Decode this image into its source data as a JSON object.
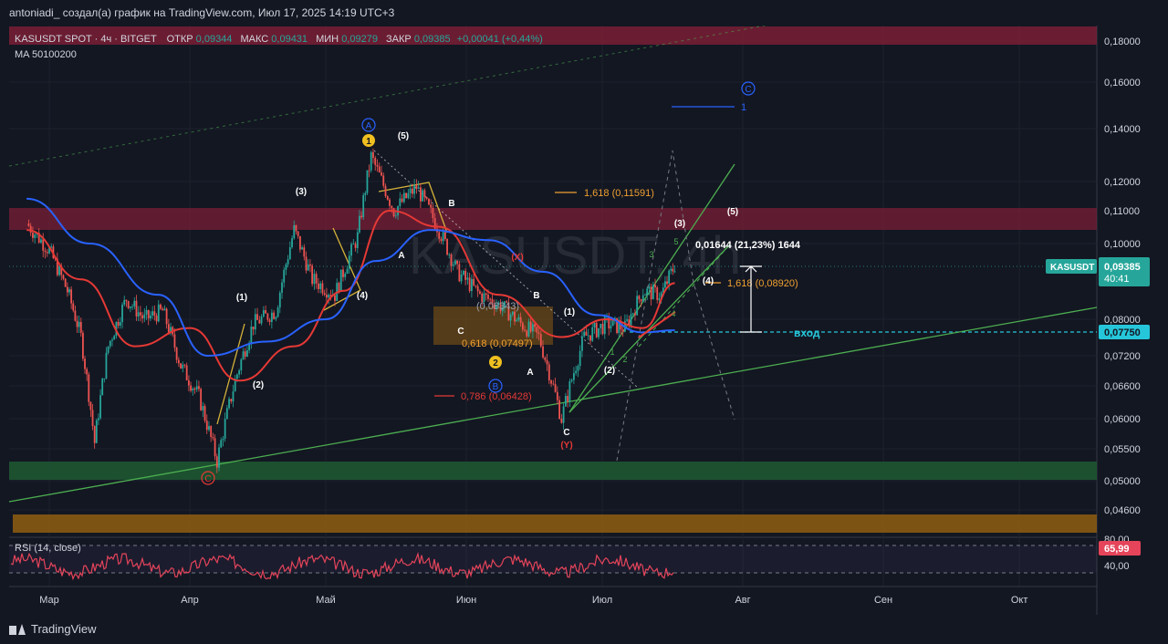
{
  "header": {
    "author_line": "antoniadi_ создал(а) график на TradingView.com, Июл 17, 2025 14:19 UTC+3"
  },
  "legend": {
    "symbol": "KASUSDT SPOT · 4ч · BITGET",
    "open_label": "ОТКР",
    "open_value": "0,09344",
    "high_label": "МАКС",
    "high_value": "0,09431",
    "low_label": "МИН",
    "low_value": "0,09279",
    "close_label": "ЗАКР",
    "close_value": "0,09385",
    "change": "+0,00041 (+0,44%)",
    "ma_line": "MA 50100200"
  },
  "watermark": "KASUSDT, 4h",
  "price_axis": {
    "ticks": [
      {
        "label": "0,18000",
        "value": 0.18
      },
      {
        "label": "0,16000",
        "value": 0.16
      },
      {
        "label": "0,14000",
        "value": 0.14
      },
      {
        "label": "0,12000",
        "value": 0.12
      },
      {
        "label": "0,11000",
        "value": 0.11
      },
      {
        "label": "0,10000",
        "value": 0.1
      },
      {
        "label": "0,08000",
        "value": 0.08
      },
      {
        "label": "0,07200",
        "value": 0.072
      },
      {
        "label": "0,06600",
        "value": 0.066
      },
      {
        "label": "0,06000",
        "value": 0.06
      },
      {
        "label": "0,05500",
        "value": 0.055
      },
      {
        "label": "0,05000",
        "value": 0.05
      },
      {
        "label": "0,04600",
        "value": 0.046
      }
    ],
    "current_symbol": "KASUSDT",
    "current_price": "0,09385",
    "countdown": "40:41",
    "entry_price": "0,07750"
  },
  "time_axis": {
    "labels": [
      {
        "label": "Мар",
        "date": "2025-03-01"
      },
      {
        "label": "Апр",
        "date": "2025-04-01"
      },
      {
        "label": "Май",
        "date": "2025-05-01"
      },
      {
        "label": "Июн",
        "date": "2025-06-01"
      },
      {
        "label": "Июл",
        "date": "2025-07-01"
      },
      {
        "label": "Авг",
        "date": "2025-08-01"
      },
      {
        "label": "Сен",
        "date": "2025-09-01"
      },
      {
        "label": "Окт",
        "date": "2025-10-01"
      }
    ]
  },
  "rsi": {
    "label": "RSI (14, close)",
    "value_label": "65,99",
    "upper": "80,00",
    "lower": "40,00",
    "upper_value": 80,
    "lower_value": 40,
    "value": 65.99
  },
  "annotations": {
    "fib_1618_top": "1,618 (0,11591)",
    "fib_1618_mid": "1,618 (0,08920)",
    "fib_618": "0,618 (0,07497)",
    "fib_786": "0,786 (0,06428)",
    "fib_0834": "(0,08343)",
    "measure": "0,01644 (21,23%) 1644",
    "entry_label": "вход",
    "target_1": "1"
  },
  "wave_labels": {
    "A_circ": "A",
    "B_circ": "B",
    "C_circ": "C",
    "C_circ_low": "C",
    "one_circ": "1",
    "two_circ": "2",
    "w5_top": "(5)",
    "w3": "(3)",
    "w1": "(1)",
    "w2": "(2)",
    "w4": "(4)",
    "A": "A",
    "B": "B",
    "X": "(X)",
    "Y": "(Y)",
    "C": "C",
    "c_small": "C",
    "B2": "B",
    "A2": "A",
    "C2": "C",
    "n1": "(1)",
    "n2": "(2)",
    "n3": "(3)",
    "n4": "(4)",
    "n5": "(5)",
    "g1": "1",
    "g2": "2",
    "g3": "3",
    "g4": "4",
    "g5": "5"
  },
  "colors": {
    "background": "#131722",
    "ma50": "#e53935",
    "ma100": "#2962ff",
    "candle_up": "#26a69a",
    "candle_down": "#ef5350",
    "resistance_zone": "#7a1f35",
    "support_zone": "#1e5631",
    "orange_zone": "#8a5a12",
    "trendline": "#4caf50",
    "rsi": "#e5445a"
  },
  "chart_data": {
    "type": "candlestick",
    "title": "KASUSDT SPOT · 4ч · BITGET",
    "series": [
      {
        "name": "KASUSDT",
        "values_description": "close",
        "points": [
          [
            "2025-02-24",
            0.106
          ],
          [
            "2025-03-01",
            0.098
          ],
          [
            "2025-03-05",
            0.087
          ],
          [
            "2025-03-08",
            0.076
          ],
          [
            "2025-03-11",
            0.056
          ],
          [
            "2025-03-14",
            0.074
          ],
          [
            "2025-03-18",
            0.085
          ],
          [
            "2025-03-22",
            0.08
          ],
          [
            "2025-03-26",
            0.082
          ],
          [
            "2025-03-30",
            0.07
          ],
          [
            "2025-04-03",
            0.064
          ],
          [
            "2025-04-07",
            0.053
          ],
          [
            "2025-04-11",
            0.067
          ],
          [
            "2025-04-15",
            0.079
          ],
          [
            "2025-04-20",
            0.082
          ],
          [
            "2025-04-24",
            0.104
          ],
          [
            "2025-04-28",
            0.09
          ],
          [
            "2025-05-03",
            0.086
          ],
          [
            "2025-05-08",
            0.102
          ],
          [
            "2025-05-11",
            0.129
          ],
          [
            "2025-05-16",
            0.11
          ],
          [
            "2025-05-21",
            0.118
          ],
          [
            "2025-05-26",
            0.104
          ],
          [
            "2025-05-30",
            0.092
          ],
          [
            "2025-06-04",
            0.086
          ],
          [
            "2025-06-09",
            0.083
          ],
          [
            "2025-06-13",
            0.079
          ],
          [
            "2025-06-17",
            0.076
          ],
          [
            "2025-06-22",
            0.06
          ],
          [
            "2025-06-27",
            0.076
          ],
          [
            "2025-07-02",
            0.079
          ],
          [
            "2025-07-06",
            0.078
          ],
          [
            "2025-07-10",
            0.087
          ],
          [
            "2025-07-14",
            0.086
          ],
          [
            "2025-07-17",
            0.09385
          ]
        ]
      },
      {
        "name": "MA 50",
        "points": [
          [
            "2025-02-24",
            0.104
          ],
          [
            "2025-03-08",
            0.09
          ],
          [
            "2025-03-20",
            0.074
          ],
          [
            "2025-04-01",
            0.078
          ],
          [
            "2025-04-12",
            0.067
          ],
          [
            "2025-04-24",
            0.074
          ],
          [
            "2025-05-05",
            0.087
          ],
          [
            "2025-05-15",
            0.11
          ],
          [
            "2025-05-26",
            0.105
          ],
          [
            "2025-06-08",
            0.086
          ],
          [
            "2025-06-22",
            0.076
          ],
          [
            "2025-07-02",
            0.08
          ],
          [
            "2025-07-10",
            0.078
          ],
          [
            "2025-07-17",
            0.089
          ]
        ]
      },
      {
        "name": "MA 100",
        "points": [
          [
            "2025-02-24",
            0.114
          ],
          [
            "2025-03-10",
            0.1
          ],
          [
            "2025-03-25",
            0.086
          ],
          [
            "2025-04-05",
            0.072
          ],
          [
            "2025-04-18",
            0.075
          ],
          [
            "2025-05-01",
            0.08
          ],
          [
            "2025-05-12",
            0.095
          ],
          [
            "2025-05-24",
            0.104
          ],
          [
            "2025-06-06",
            0.101
          ],
          [
            "2025-06-18",
            0.092
          ],
          [
            "2025-06-30",
            0.081
          ],
          [
            "2025-07-10",
            0.077
          ],
          [
            "2025-07-17",
            0.0775
          ]
        ]
      }
    ],
    "xlim": [
      "2025-02-20",
      "2025-10-25"
    ],
    "ylim": [
      0.044,
      0.19
    ],
    "log_scale": true,
    "grid": true
  }
}
